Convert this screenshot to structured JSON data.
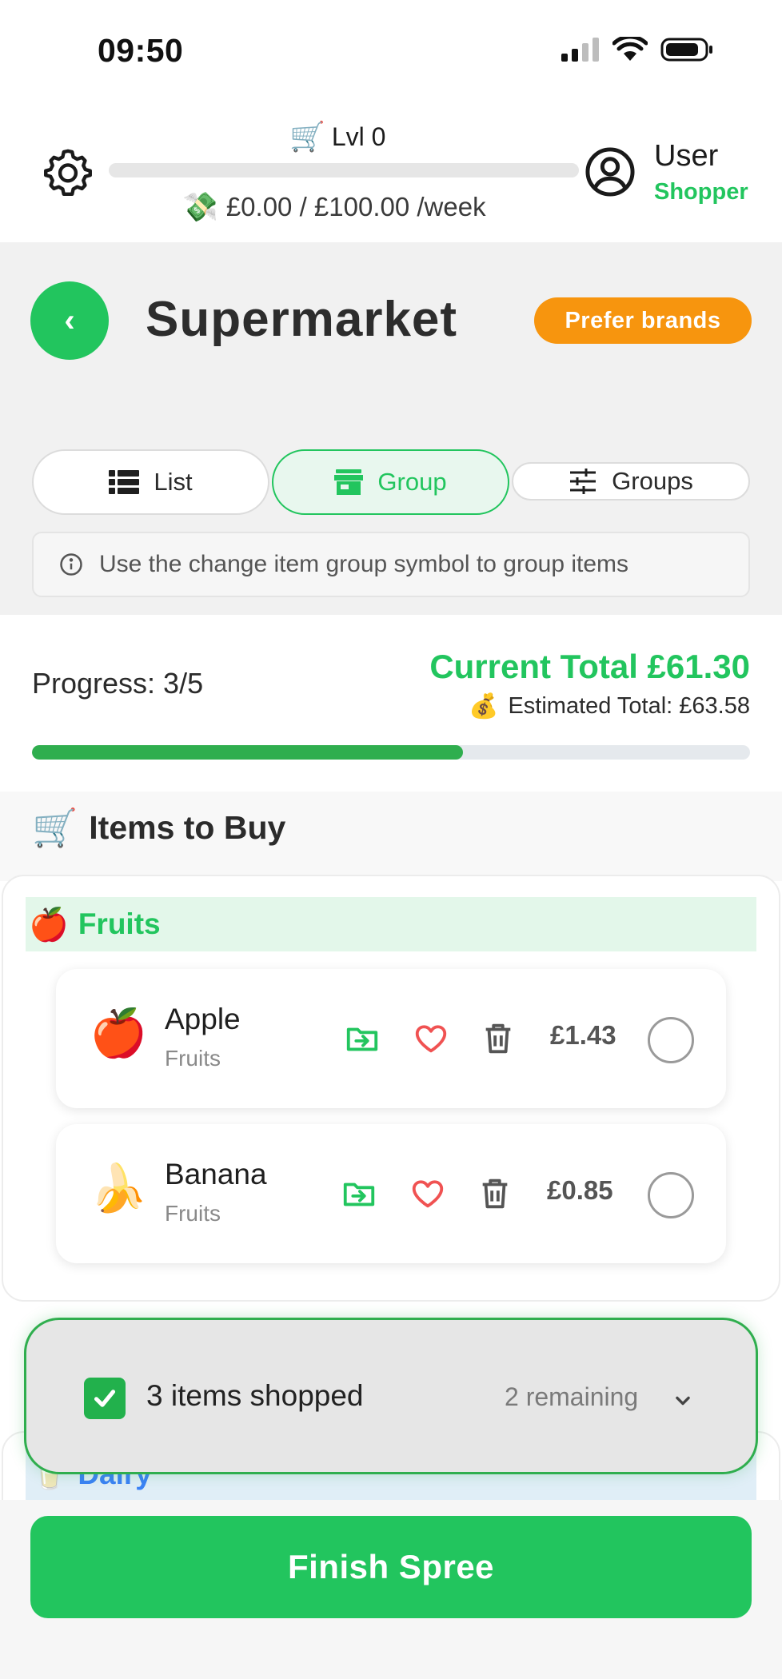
{
  "status_bar": {
    "time": "09:50"
  },
  "header": {
    "level_icon": "shopping-cart-emoji",
    "level_label": "Lvl 0",
    "xp_progress": 0.0,
    "budget_icon": "money-with-wings-emoji",
    "budget_text": "£0.00 / £100.00 /week",
    "user_name": "User",
    "user_role": "Shopper"
  },
  "store": {
    "back_label": "‹",
    "title": "Supermarket",
    "preference_badge": "Prefer brands"
  },
  "tabs": [
    {
      "label": "List",
      "icon": "list-icon",
      "active": false
    },
    {
      "label": "Group",
      "icon": "store-icon",
      "active": true
    },
    {
      "label": "Groups",
      "icon": "sliders-icon",
      "active": false
    }
  ],
  "info": {
    "text": "Use the change item group symbol to group items"
  },
  "progress": {
    "label": "Progress: 3/5",
    "fraction": 0.6,
    "current_total": "Current Total £61.30",
    "estimated_total": "Estimated Total: £63.58"
  },
  "section": {
    "title": "Items to Buy",
    "icon": "shopping-cart-emoji"
  },
  "groups": [
    {
      "name": "Fruits",
      "emoji": "🍎",
      "items": [
        {
          "name": "Apple",
          "category": "Fruits",
          "emoji": "🍎",
          "price": "£1.43",
          "checked": false
        },
        {
          "name": "Banana",
          "category": "Fruits",
          "emoji": "🍌",
          "price": "£0.85",
          "checked": false
        }
      ]
    },
    {
      "name": "Dairy",
      "emoji": "🥛"
    }
  ],
  "shopped_bar": {
    "shopped_text": "3 items shopped",
    "remaining_text": "2 remaining"
  },
  "finish_button": "Finish Spree",
  "colors": {
    "accent": "#22c55e",
    "badge": "#f7950e",
    "heart": "#f05252",
    "dairy": "#3b82f6"
  }
}
